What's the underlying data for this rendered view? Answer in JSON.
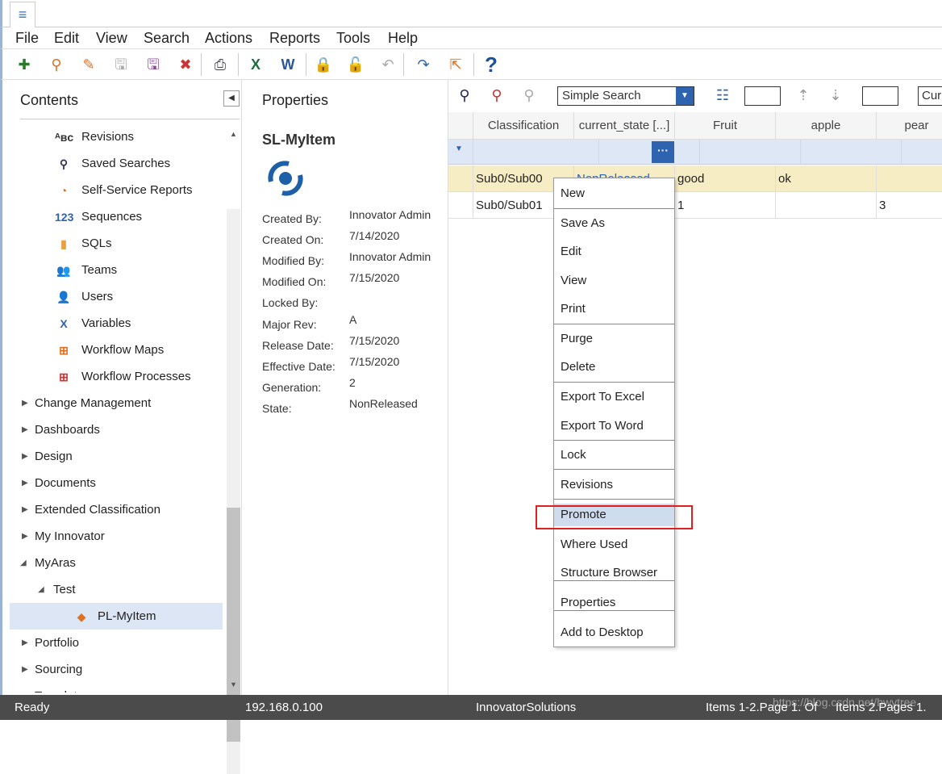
{
  "menu": [
    "File",
    "Edit",
    "View",
    "Search",
    "Actions",
    "Reports",
    "Tools",
    "Help"
  ],
  "toolbar_icons": [
    "new-icon",
    "open-icon",
    "edit-icon",
    "save-icon",
    "save-as-icon",
    "delete-icon",
    "print-icon",
    "excel-icon",
    "word-icon",
    "lock-icon",
    "unlock-icon",
    "undo-icon",
    "promote-icon",
    "export-icon",
    "help-icon"
  ],
  "contents": {
    "title": "Contents",
    "children": [
      "Revisions",
      "Saved Searches",
      "Self-Service Reports",
      "Sequences",
      "SQLs",
      "Teams",
      "Users",
      "Variables",
      "Workflow Maps",
      "Workflow Processes"
    ],
    "folders": [
      "Change Management",
      "Dashboards",
      "Design",
      "Documents",
      "Extended Classification",
      "My Innovator",
      "MyAras"
    ],
    "test": "Test",
    "selected": "PL-MyItem",
    "after": [
      "Portfolio",
      "Sourcing",
      "Templates"
    ]
  },
  "properties": {
    "title": "Properties",
    "item": "SL-MyItem",
    "fields": [
      {
        "label": "Created By:",
        "value": "Innovator Admin"
      },
      {
        "label": "Created On:",
        "value": "7/14/2020"
      },
      {
        "label": "Modified By:",
        "value": "Innovator Admin"
      },
      {
        "label": "Modified On:",
        "value": "7/15/2020"
      },
      {
        "label": "Locked By:",
        "value": ""
      },
      {
        "label": "Major Rev:",
        "value": "A"
      },
      {
        "label": "Release Date:",
        "value": "7/15/2020"
      },
      {
        "label": "Effective Date:",
        "value": "7/15/2020"
      },
      {
        "label": "Generation:",
        "value": "2"
      },
      {
        "label": "State:",
        "value": "NonReleased"
      }
    ]
  },
  "grid": {
    "search_mode": "Simple Search",
    "current_label": "Curr",
    "columns": [
      "Classification",
      "current_state [...]",
      "Fruit",
      "apple",
      "pear"
    ],
    "rows": [
      [
        "Sub0/Sub00",
        "NonReleased",
        "good",
        "ok",
        ""
      ],
      [
        "Sub0/Sub01",
        "",
        "1",
        "",
        "3"
      ]
    ]
  },
  "context_menu": [
    [
      "New"
    ],
    [
      "Save As",
      "Edit",
      "View",
      "Print"
    ],
    [
      "Purge",
      "Delete"
    ],
    [
      "Export To Excel",
      "Export To Word"
    ],
    [
      "Lock"
    ],
    [
      "Revisions"
    ],
    [
      "Promote",
      "Where Used",
      "Structure Browser"
    ],
    [
      "Properties"
    ],
    [
      "Add to Desktop"
    ]
  ],
  "highlighted": "Promote",
  "status": {
    "state": "Ready",
    "ip": "192.168.0.100",
    "db": "InnovatorSolutions",
    "items": "Items 1-2.Page 1. Of",
    "pages": "Items 2.Pages 1.",
    "watermark": "https://blog.csdn.net/hwytree"
  },
  "colors": {
    "accent": "#2e63b0",
    "selected_row": "#f7edc4",
    "filter_row": "#dde7f5",
    "highlight_box": "#e02020",
    "status_bg": "#4b4b4b"
  }
}
